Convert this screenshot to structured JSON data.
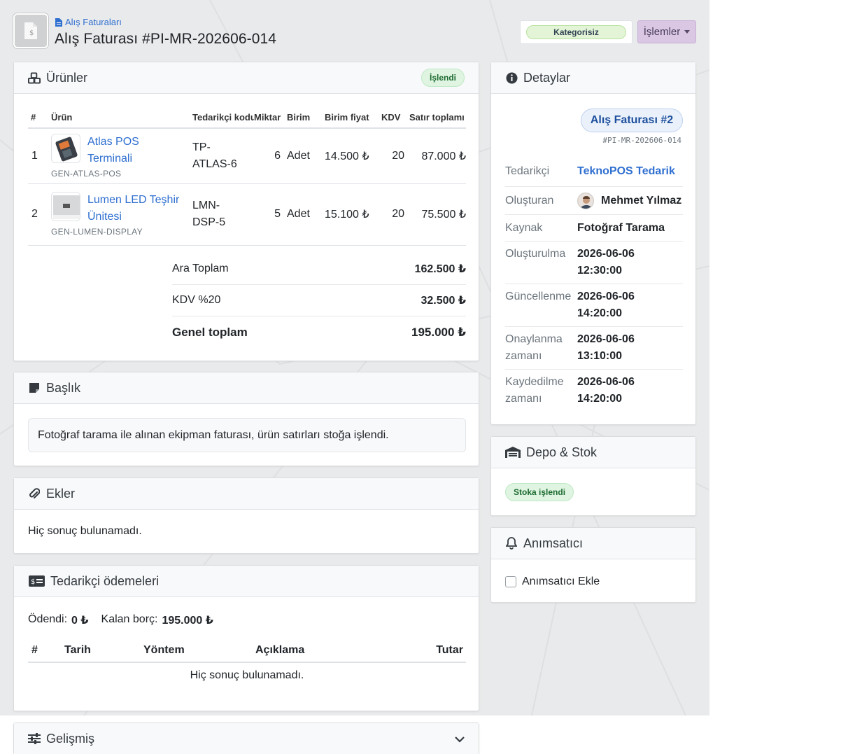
{
  "header": {
    "breadcrumb": "Alış Faturaları",
    "title": "Alış Faturası #PI-MR-202606-014",
    "category_badge": "Kategorisiz",
    "actions_label": "İşlemler"
  },
  "products": {
    "title": "Ürünler",
    "status_badge": "İşlendi",
    "columns": [
      "#",
      "Ürün",
      "Tedarikçi kodu",
      "Miktar",
      "Birim",
      "Birim fiyat",
      "KDV",
      "Satır toplamı"
    ],
    "rows": [
      {
        "no": "1",
        "name": "Atlas POS Terminali",
        "sku": "GEN-ATLAS-POS",
        "supplier_code": "TP-ATLAS-6",
        "qty": "6",
        "unit": "Adet",
        "unit_price": "14.500 ₺",
        "vat": "20",
        "total": "87.000 ₺"
      },
      {
        "no": "2",
        "name": "Lumen LED Teşhir Ünitesi",
        "sku": "GEN-LUMEN-DISPLAY",
        "supplier_code": "LMN-DSP-5",
        "qty": "5",
        "unit": "Adet",
        "unit_price": "15.100 ₺",
        "vat": "20",
        "total": "75.500 ₺"
      }
    ],
    "subtotal_label": "Ara Toplam",
    "subtotal_value": "162.500 ₺",
    "vat_label": "KDV %20",
    "vat_value": "32.500 ₺",
    "grand_label": "Genel toplam",
    "grand_value": "195.000 ₺"
  },
  "note": {
    "title": "Başlık",
    "text": "Fotoğraf tarama ile alınan ekipman faturası, ürün satırları stoğa işlendi."
  },
  "attachments": {
    "title": "Ekler",
    "empty": "Hiç sonuç bulunamadı."
  },
  "payments": {
    "title": "Tedarikçi ödemeleri",
    "paid_label": "Ödendi:",
    "paid_value": "0 ₺",
    "remaining_label": "Kalan borç:",
    "remaining_value": "195.000 ₺",
    "columns": [
      "#",
      "Tarih",
      "Yöntem",
      "Açıklama",
      "Tutar"
    ],
    "empty": "Hiç sonuç bulunamadı."
  },
  "advanced": {
    "title": "Gelişmiş"
  },
  "details": {
    "title": "Detaylar",
    "pill": "Alış Faturası #2",
    "code": "#PI-MR-202606-014",
    "supplier_label": "Tedarikçi",
    "supplier_value": "TeknoPOS Tedarik",
    "creator_label": "Oluşturan",
    "creator_value": "Mehmet Yılmaz",
    "source_label": "Kaynak",
    "source_value": "Fotoğraf Tarama",
    "created_label": "Oluşturulma",
    "created_date": "2026-06-06",
    "created_time": "12:30:00",
    "updated_label": "Güncellenme",
    "updated_date": "2026-06-06",
    "updated_time": "14:20:00",
    "approved_label_1": "Onaylanma",
    "approved_label_2": "zamanı",
    "approved_date": "2026-06-06",
    "approved_time": "13:10:00",
    "saved_label_1": "Kaydedilme",
    "saved_label_2": "zamanı",
    "saved_date": "2026-06-06",
    "saved_time": "14:20:00"
  },
  "warehouse": {
    "title": "Depo & Stok",
    "badge": "Stoka işlendi"
  },
  "reminder": {
    "title": "Anımsatıcı",
    "checkbox_label": "Anımsatıcı Ekle"
  },
  "colors": {
    "link": "#2f6fd0",
    "success_bg": "#dff5e1",
    "actions_bg": "#d9c7e3"
  }
}
